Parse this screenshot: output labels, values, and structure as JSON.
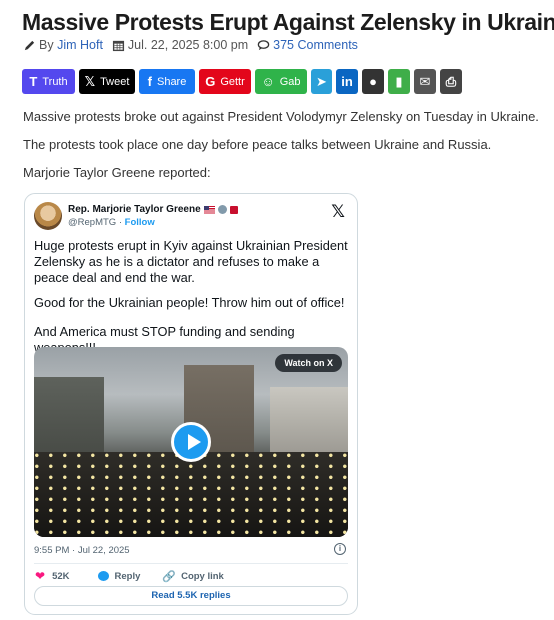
{
  "article": {
    "title": "Massive Protests Erupt Against Zelensky in Ukraine",
    "meta": {
      "by": "By",
      "author": "Jim Hoft",
      "date": "Jul. 22, 2025 8:00 pm",
      "comments": "375 Comments"
    },
    "paragraphs": [
      "Massive protests broke out against President Volodymyr Zelensky on Tuesday in Ukraine.",
      "The protests took place one day before peace talks between Ukraine and Russia.",
      "Marjorie Taylor Greene reported:"
    ]
  },
  "share_buttons": [
    {
      "label": "Truth",
      "glyph": "T",
      "icon": "truth-social-icon",
      "color": "#5448ee"
    },
    {
      "label": "Tweet",
      "glyph": "𝕏",
      "icon": "x-icon",
      "color": "#000000"
    },
    {
      "label": "Share",
      "glyph": "f",
      "icon": "facebook-icon",
      "color": "#1877f2"
    },
    {
      "label": "Gettr",
      "glyph": "G",
      "icon": "gettr-icon",
      "color": "#e3061b"
    },
    {
      "label": "Gab",
      "glyph": "☺",
      "icon": "gab-icon",
      "color": "#2fb34a"
    },
    {
      "label": "",
      "glyph": "➤",
      "icon": "telegram-icon",
      "color": "#2aa0d9"
    },
    {
      "label": "",
      "glyph": "in",
      "icon": "linkedin-icon",
      "color": "#0a66c2"
    },
    {
      "label": "",
      "glyph": "●",
      "icon": "comment-icon",
      "color": "#333333"
    },
    {
      "label": "",
      "glyph": "▮",
      "icon": "sms-icon",
      "color": "#3fae49"
    },
    {
      "label": "",
      "glyph": "✉",
      "icon": "email-icon",
      "color": "#555555"
    },
    {
      "label": "",
      "glyph": "⎙",
      "icon": "print-icon",
      "color": "#444444"
    }
  ],
  "tweet": {
    "display_name": "Rep. Marjorie Taylor Greene",
    "handle": "@RepMTG",
    "separator": " · ",
    "follow": "Follow",
    "lines": [
      "Huge protests erupt in Kyiv against Ukrainian President Zelensky as he is a dictator and refuses to make a peace deal and end the war.",
      "Good for the Ukrainian people! Throw him out of office!",
      "And America must STOP funding and sending weapons!!!"
    ],
    "media_label": "Watch on X",
    "timestamp": "9:55 PM · Jul 22, 2025",
    "likes": "52K",
    "reply": "Reply",
    "copy_link": "Copy link",
    "read_replies": "Read 5.5K replies"
  }
}
